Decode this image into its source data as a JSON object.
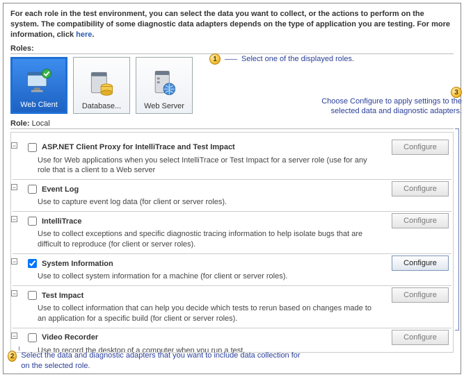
{
  "intro": {
    "text": "For each role in the test environment, you can select the data you want to collect, or the actions to perform on the system. The compatibility of some diagnostic data adapters depends on the type of application you are testing. For more information, click ",
    "link": "here"
  },
  "rolesLabel": "Roles:",
  "roles": [
    {
      "label": "Web Client",
      "selected": true
    },
    {
      "label": "Database...",
      "selected": false
    },
    {
      "label": "Web Server",
      "selected": false
    }
  ],
  "callouts": {
    "c1": "Select one of the displayed roles.",
    "c2": "Select the data and diagnostic adapters that you want to include data collection for on the selected role.",
    "c3": "Choose Configure to apply settings to the selected data and diagnostic adapters."
  },
  "roleLine": {
    "label": "Role:",
    "value": "Local"
  },
  "configureLabel": "Configure",
  "adapters": [
    {
      "title": "ASP.NET Client Proxy for IntelliTrace and Test Impact",
      "desc": "Use for Web applications when you select IntelliTrace or Test Impact for a server role (use for any role that is a client to a Web server",
      "checked": false,
      "configEnabled": false
    },
    {
      "title": "Event Log",
      "desc": "Use to capture event log data (for client or server roles).",
      "checked": false,
      "configEnabled": false
    },
    {
      "title": "IntelliTrace",
      "desc": "Use to collect exceptions and specific diagnostic tracing information to help isolate bugs that are difficult to reproduce (for client or server roles).",
      "checked": false,
      "configEnabled": false
    },
    {
      "title": "System Information",
      "desc": "Use to collect system information for a machine (for client or server roles).",
      "checked": true,
      "configEnabled": true
    },
    {
      "title": "Test Impact",
      "desc": "Use to collect information that can help you decide which tests to rerun based on changes made to an application for a specific build (for client or server roles).",
      "checked": false,
      "configEnabled": false
    },
    {
      "title": "Video Recorder",
      "desc": "Use to record the desktop of a computer when you run a test.",
      "checked": false,
      "configEnabled": false
    }
  ]
}
